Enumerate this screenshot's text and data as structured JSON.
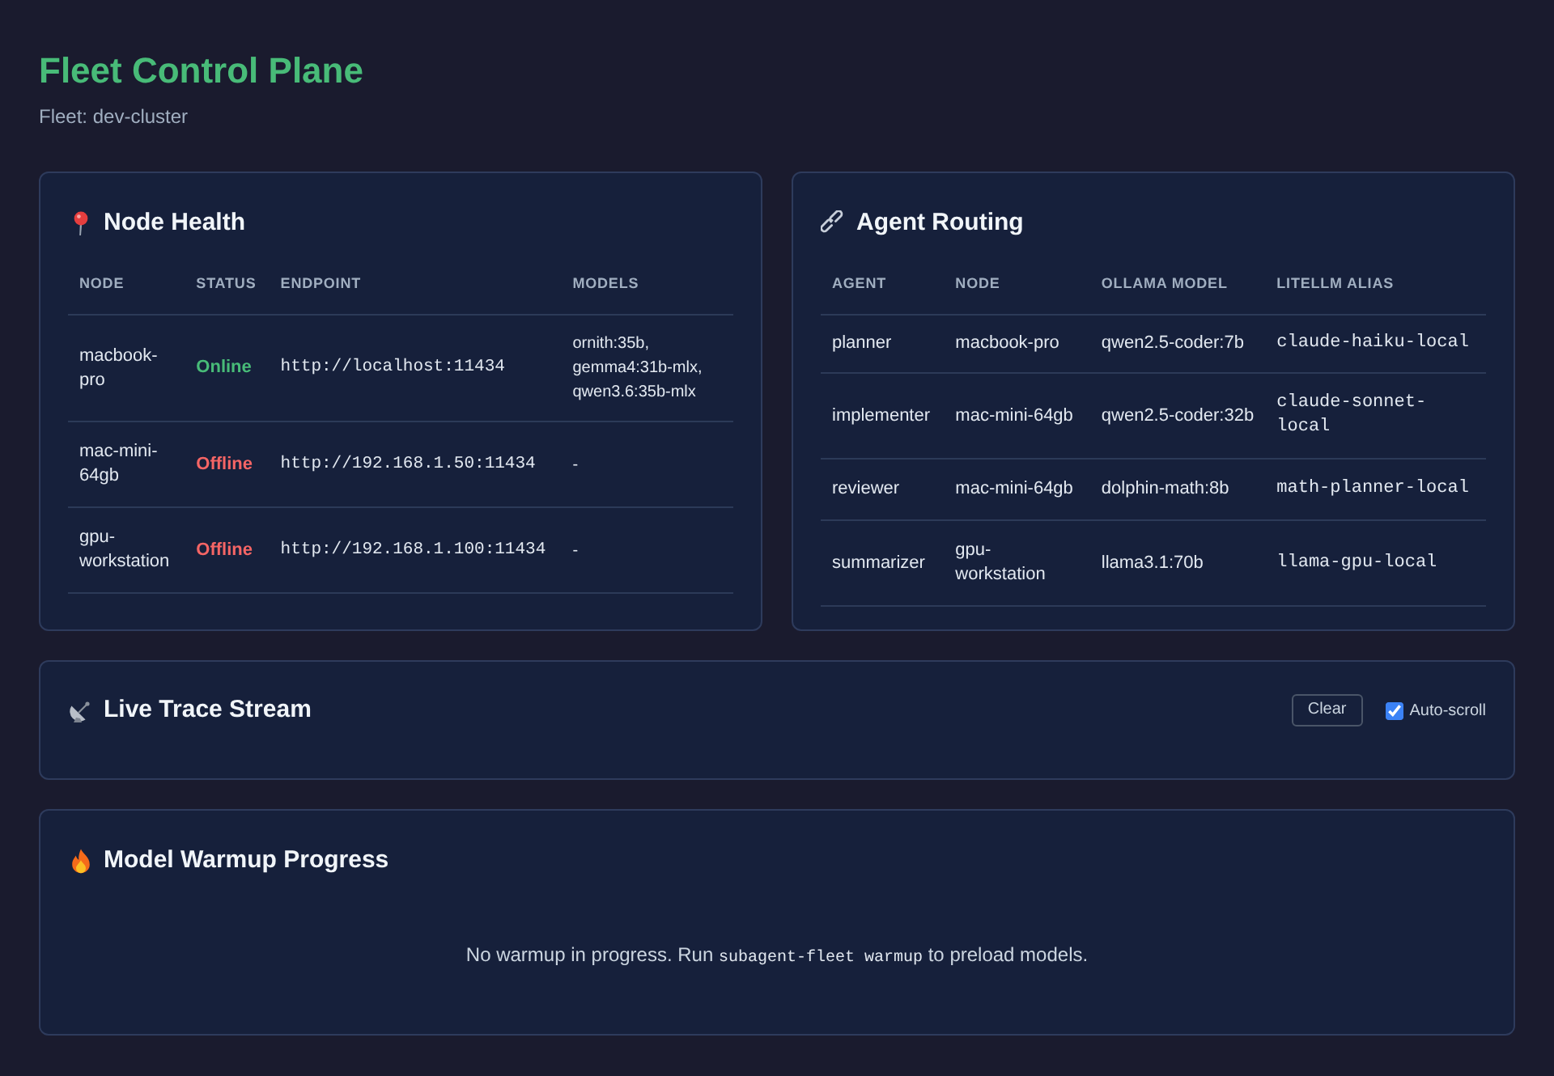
{
  "header": {
    "title": "Fleet Control Plane",
    "subtitle": "Fleet: dev-cluster"
  },
  "node_health": {
    "title": "Node Health",
    "columns": [
      "NODE",
      "STATUS",
      "ENDPOINT",
      "MODELS"
    ],
    "rows": [
      {
        "node": "macbook-pro",
        "status": "Online",
        "online": true,
        "endpoint": "http://localhost:11434",
        "models": "ornith:35b, gemma4:31b-mlx, qwen3.6:35b-mlx"
      },
      {
        "node": "mac-mini-64gb",
        "status": "Offline",
        "online": false,
        "endpoint": "http://192.168.1.50:11434",
        "models": "-"
      },
      {
        "node": "gpu-workstation",
        "status": "Offline",
        "online": false,
        "endpoint": "http://192.168.1.100:11434",
        "models": "-"
      }
    ]
  },
  "agent_routing": {
    "title": "Agent Routing",
    "columns": [
      "AGENT",
      "NODE",
      "OLLAMA MODEL",
      "LITELLM ALIAS"
    ],
    "rows": [
      {
        "agent": "planner",
        "node": "macbook-pro",
        "ollama_model": "qwen2.5-coder:7b",
        "litellm_alias": "claude-haiku-local"
      },
      {
        "agent": "implementer",
        "node": "mac-mini-64gb",
        "ollama_model": "qwen2.5-coder:32b",
        "litellm_alias": "claude-sonnet-local"
      },
      {
        "agent": "reviewer",
        "node": "mac-mini-64gb",
        "ollama_model": "dolphin-math:8b",
        "litellm_alias": "math-planner-local"
      },
      {
        "agent": "summarizer",
        "node": "gpu-workstation",
        "ollama_model": "llama3.1:70b",
        "litellm_alias": "llama-gpu-local"
      }
    ]
  },
  "trace_stream": {
    "title": "Live Trace Stream",
    "clear_button": "Clear",
    "auto_scroll": {
      "label": "Auto-scroll",
      "checked": true
    }
  },
  "warmup": {
    "title": "Model Warmup Progress",
    "message": {
      "before": "No warmup in progress. Run",
      "command": "subagent-fleet warmup",
      "after": "to preload models."
    }
  }
}
